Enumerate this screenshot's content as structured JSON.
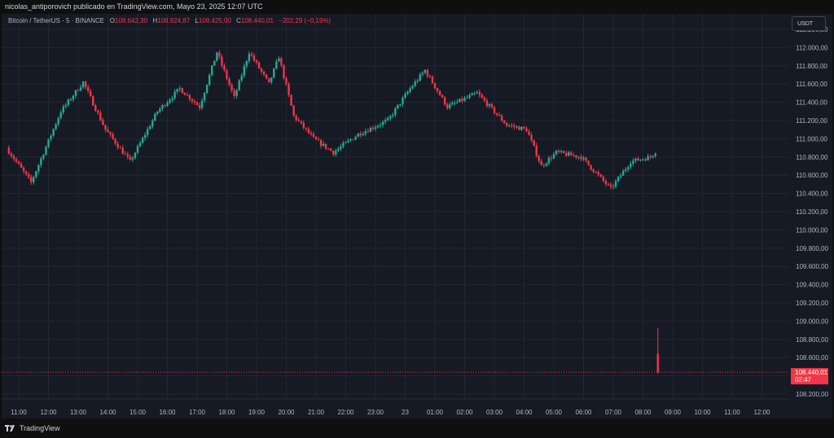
{
  "header": {
    "publish_line": "nicolas_antiporovich publicado en TradingView.com, Mayo 23, 2025 12:07 UTC"
  },
  "legend": {
    "symbol": "Bitcoin / TetherUS · 5 · BINANCE",
    "open_label": "O",
    "open": "108.642,30",
    "high_label": "H",
    "high": "108.924,87",
    "low_label": "L",
    "low": "108.425,00",
    "close_label": "C",
    "close": "108.440,01",
    "change": "−202,29 (−0,19%)"
  },
  "currency_button": "USDT",
  "price_tag": {
    "value": "108.440,01",
    "countdown": "02:47"
  },
  "footer": {
    "brand": "TradingView"
  },
  "colors": {
    "background": "#161a25",
    "grid": "#232733",
    "up": "#22ab94",
    "down": "#f23645",
    "axis_text": "#b2b5be",
    "price_tag": "#f23645"
  },
  "icons": {
    "brand_logo": "tradingview-logo-icon"
  },
  "chart_data": {
    "type": "candlestick",
    "series_interval_minutes": 5,
    "first_candle_time": "2025-05-22 10:40",
    "last_candle_time": "2025-05-23 12:45",
    "candle_count": 263,
    "xlabels": [
      "11:00",
      "12:00",
      "13:00",
      "14:00",
      "15:00",
      "16:00",
      "17:00",
      "18:00",
      "19:00",
      "20:00",
      "21:00",
      "22:00",
      "23:00",
      "23",
      "01:00",
      "02:00",
      "03:00",
      "04:00",
      "05:00",
      "06:00",
      "07:00",
      "08:00",
      "09:00",
      "10:00",
      "11:00",
      "12:00"
    ],
    "yticks": [
      "112.200,00",
      "112.000,00",
      "111.800,00",
      "111.600,00",
      "111.400,00",
      "111.200,00",
      "111.000,00",
      "110.800,00",
      "110.600,00",
      "110.400,00",
      "110.200,00",
      "110.000,00",
      "109.800,00",
      "109.600,00",
      "109.400,00",
      "109.200,00",
      "109.000,00",
      "108.800,00",
      "108.600,00",
      "108.400,00",
      "108.200,00"
    ],
    "ylim": [
      108150,
      112250
    ],
    "last_price": 108440.01,
    "last_candle": {
      "open": 108642.3,
      "high": 108924.87,
      "low": 108425.0,
      "close": 108440.01
    },
    "path_keypoints": [
      {
        "time": "2025-05-22 10:40",
        "price": 110900
      },
      {
        "time": "2025-05-22 11:30",
        "price": 110520
      },
      {
        "time": "2025-05-22 12:30",
        "price": 111300
      },
      {
        "time": "2025-05-22 13:15",
        "price": 111620
      },
      {
        "time": "2025-05-22 14:00",
        "price": 111100
      },
      {
        "time": "2025-05-22 14:50",
        "price": 110750
      },
      {
        "time": "2025-05-22 15:45",
        "price": 111300
      },
      {
        "time": "2025-05-22 16:30",
        "price": 111550
      },
      {
        "time": "2025-05-22 17:10",
        "price": 111350
      },
      {
        "time": "2025-05-22 17:45",
        "price": 111950
      },
      {
        "time": "2025-05-22 18:20",
        "price": 111450
      },
      {
        "time": "2025-05-22 18:50",
        "price": 111950
      },
      {
        "time": "2025-05-22 19:30",
        "price": 111600
      },
      {
        "time": "2025-05-22 19:50",
        "price": 111900
      },
      {
        "time": "2025-05-22 20:20",
        "price": 111250
      },
      {
        "time": "2025-05-22 21:00",
        "price": 111000
      },
      {
        "time": "2025-05-22 21:40",
        "price": 110850
      },
      {
        "time": "2025-05-22 22:30",
        "price": 111050
      },
      {
        "time": "2025-05-22 23:30",
        "price": 111200
      },
      {
        "time": "2025-05-23 00:15",
        "price": 111550
      },
      {
        "time": "2025-05-23 00:45",
        "price": 111750
      },
      {
        "time": "2025-05-23 01:30",
        "price": 111350
      },
      {
        "time": "2025-05-23 02:30",
        "price": 111500
      },
      {
        "time": "2025-05-23 03:30",
        "price": 111150
      },
      {
        "time": "2025-05-23 04:10",
        "price": 111100
      },
      {
        "time": "2025-05-23 04:40",
        "price": 110700
      },
      {
        "time": "2025-05-23 05:10",
        "price": 110850
      },
      {
        "time": "2025-05-23 06:00",
        "price": 110800
      },
      {
        "time": "2025-05-23 07:00",
        "price": 110450
      },
      {
        "time": "2025-05-23 07:40",
        "price": 110750
      },
      {
        "time": "2025-05-23 08:20",
        "price": 110800
      },
      {
        "time": "2025-05-23 08:45",
        "price": 110950
      },
      {
        "time": "2025-05-23 09:30",
        "price": 111050
      },
      {
        "time": "2025-05-23 10:00",
        "price": 111350
      },
      {
        "time": "2025-05-23 10:40",
        "price": 110950
      },
      {
        "time": "2025-05-23 11:10",
        "price": 111050
      },
      {
        "time": "2025-05-23 11:45",
        "price": 110850
      },
      {
        "time": "2025-05-23 12:00",
        "price": 110400
      },
      {
        "time": "2025-05-23 12:20",
        "price": 109700
      },
      {
        "time": "2025-05-23 12:35",
        "price": 109000
      },
      {
        "time": "2025-05-23 12:45",
        "price": 108440
      }
    ]
  }
}
